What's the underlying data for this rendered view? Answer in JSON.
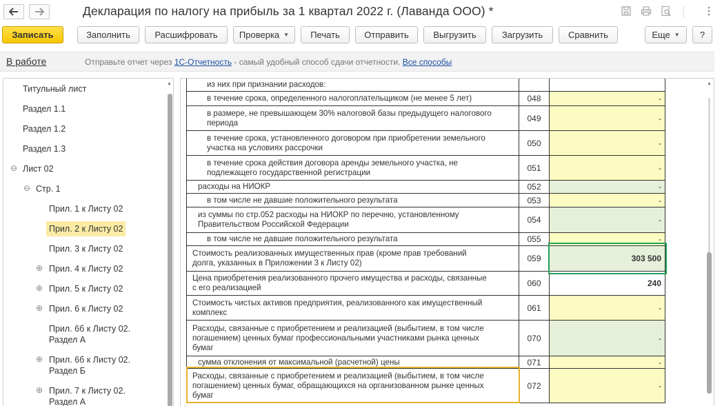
{
  "window": {
    "title": "Декларация по налогу на прибыль за 1 квартал 2022 г. (Лаванда ООО) *"
  },
  "toolbar": {
    "buttons": [
      {
        "label": "Записать"
      },
      {
        "label": "Заполнить"
      },
      {
        "label": "Расшифровать"
      },
      {
        "label": "Проверка"
      },
      {
        "label": "Печать"
      },
      {
        "label": "Отправить"
      },
      {
        "label": "Выгрузить"
      },
      {
        "label": "Загрузить"
      },
      {
        "label": "Сравнить"
      },
      {
        "label": "Еще"
      },
      {
        "label": "?"
      }
    ]
  },
  "infobar": {
    "status": "В работе",
    "text_prefix": "Отправьте отчет через ",
    "link1": "1С-Отчетность",
    "text_middle": " - самый удобный способ сдачи отчетности. ",
    "link2": "Все способы"
  },
  "tree": {
    "items": [
      {
        "label": "Титульный лист"
      },
      {
        "label": "Раздел 1.1"
      },
      {
        "label": "Раздел 1.2"
      },
      {
        "label": "Раздел 1.3"
      },
      {
        "label": "Лист 02"
      },
      {
        "label": "Стр. 1"
      },
      {
        "label": "Прил. 1 к Листу 02"
      },
      {
        "label": "Прил. 2 к Листу 02"
      },
      {
        "label": "Прил. 3 к Листу 02"
      },
      {
        "label": "Прил. 4 к Листу 02"
      },
      {
        "label": "Прил. 5 к Листу 02"
      },
      {
        "label": "Прил. 6 к Листу 02"
      },
      {
        "label": "Прил. 6б к Листу 02.",
        "label2": "Раздел А"
      },
      {
        "label": "Прил. 6б к Листу 02.",
        "label2": "Раздел Б"
      },
      {
        "label": "Прил. 7 к Листу 02.",
        "label2": "Раздел А"
      }
    ]
  },
  "form": {
    "rows": [
      {
        "desc": "из них при признании расходов:",
        "code": "",
        "value": ""
      },
      {
        "desc": "в течение срока, определенного налогоплательщиком (не менее 5 лет)",
        "code": "048",
        "value": "-"
      },
      {
        "desc": "в размере, не превышающем 30% налоговой базы предыдущего налогового",
        "desc2": "периода",
        "code": "049",
        "value": "-"
      },
      {
        "desc": "в течение срока, установленного договором при приобретении земельного",
        "desc2": "участка на условиях рассрочки",
        "code": "050",
        "value": "-"
      },
      {
        "desc": "в течение срока действия договора аренды земельного участка, не",
        "desc2": "подлежащего государственной регистрации",
        "code": "051",
        "value": "-"
      },
      {
        "desc": "расходы на НИОКР",
        "code": "052",
        "value": "-"
      },
      {
        "desc": "в том числе не давшие положительного результата",
        "code": "053",
        "value": "-"
      },
      {
        "desc": "из суммы по стр.052 расходы на НИОКР по перечню, установленному",
        "desc2": "Правительством Российской Федерации",
        "code": "054",
        "value": "-"
      },
      {
        "desc": "в том числе не давшие положительного результата",
        "code": "055",
        "value": "-"
      },
      {
        "desc": "Стоимость реализованных имущественных прав (кроме прав требований",
        "desc2": "долга, указанных в Приложении 3 к Листу 02)",
        "code": "059",
        "value": "303 500"
      },
      {
        "desc": "Цена приобретения реализованного прочего имущества и расходы, связанные",
        "desc2": "с его реализацией",
        "code": "060",
        "value": "240"
      },
      {
        "desc": "Стоимость чистых активов предприятия, реализованного как имущественный",
        "desc2": "комплекс",
        "code": "061",
        "value": "-"
      },
      {
        "desc": "Расходы, связанные с приобретением и реализацией (выбытием, в том числе",
        "desc2": "погашением) ценных бумаг профессиональными участниками рынка ценных",
        "desc3": "бумаг",
        "code": "070",
        "value": "-"
      },
      {
        "desc": "сумма отклонения от максимальной (расчетной) цены",
        "code": "071",
        "value": "-"
      },
      {
        "desc": "Расходы, связанные с приобретением и реализацией (выбытием, в том числе",
        "desc2": "погашением) ценных бумаг, обращающихся на организованном рынке ценных",
        "desc3": "бумаг",
        "code": "072",
        "value": "-"
      }
    ]
  },
  "colors": {
    "primary_button": "#f6c600",
    "input_yellow": "#fcfbc1",
    "computed_green": "#e6efd9",
    "selected_tree": "#fbeba4",
    "highlight_green": "#22a15a",
    "highlight_orange": "#e7b12c",
    "link": "#1a4fa3"
  }
}
